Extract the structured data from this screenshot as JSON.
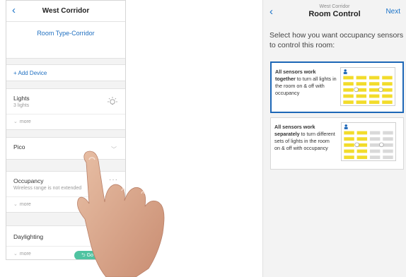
{
  "left_screen": {
    "back_icon": "chevron-left-icon",
    "title": "West Corridor",
    "room_type": "Room Type-Corridor",
    "add_device": "+ Add Device",
    "lights": {
      "name": "Lights",
      "sub": "3 lights",
      "icon": "light-bulb-icon",
      "more": "more"
    },
    "pico": {
      "name": "Pico",
      "icon": "chevron-down-icon"
    },
    "occupancy": {
      "name": "Occupancy",
      "sub": "Wireless range is not extended",
      "menu": "···",
      "more": "more"
    },
    "daylighting": {
      "name": "Daylighting",
      "more": "more"
    },
    "goto_button": "Go to"
  },
  "right_screen": {
    "back_icon": "chevron-left-icon",
    "subtitle": "West Corridor",
    "title": "Room Control",
    "next": "Next",
    "prompt": "Select how you want occupancy sensors to control this room:",
    "options": [
      {
        "bold": "All sensors work together",
        "rest": " to turn all lights in the room on & off with occupancy",
        "selected": true
      },
      {
        "bold": "All sensors work separately",
        "rest": " to turn different sets of lights in the room on & off with occupancy",
        "selected": false
      }
    ]
  },
  "colors": {
    "accent": "#1f6fc0",
    "selected_border": "#1d67b7",
    "light_on": "#f2dc2b",
    "light_off": "#d9d9d9",
    "go_button": "#4fc3a1"
  }
}
